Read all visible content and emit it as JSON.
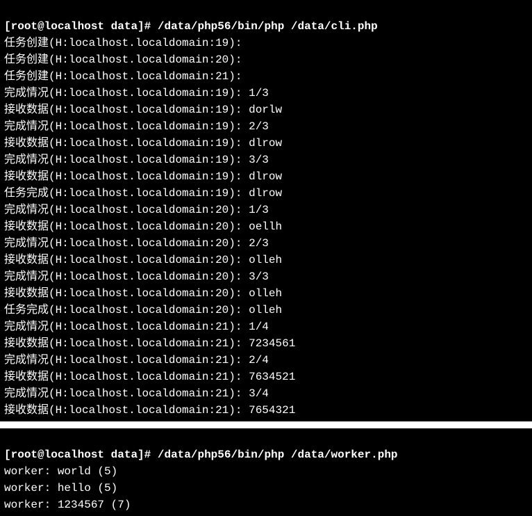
{
  "terminal1": {
    "prompt": {
      "open": "[",
      "user_host": "root@localhost",
      "sep": " ",
      "cwd": "data",
      "close": "]# ",
      "command": "/data/php56/bin/php /data/cli.php"
    },
    "lines": [
      {
        "label": "任务创建",
        "host": "H:localhost.localdomain",
        "id": "19",
        "after": ":",
        "extra": ""
      },
      {
        "label": "任务创建",
        "host": "H:localhost.localdomain",
        "id": "20",
        "after": ":",
        "extra": ""
      },
      {
        "label": "任务创建",
        "host": "H:localhost.localdomain",
        "id": "21",
        "after": ":",
        "extra": ""
      },
      {
        "label": "完成情况",
        "host": "H:localhost.localdomain",
        "id": "19",
        "after": ": ",
        "extra": "1/3"
      },
      {
        "label": "接收数据",
        "host": "H:localhost.localdomain",
        "id": "19",
        "after": ": ",
        "extra": "dorlw"
      },
      {
        "label": "完成情况",
        "host": "H:localhost.localdomain",
        "id": "19",
        "after": ": ",
        "extra": "2/3"
      },
      {
        "label": "接收数据",
        "host": "H:localhost.localdomain",
        "id": "19",
        "after": ": ",
        "extra": "dlrow"
      },
      {
        "label": "完成情况",
        "host": "H:localhost.localdomain",
        "id": "19",
        "after": ": ",
        "extra": "3/3"
      },
      {
        "label": "接收数据",
        "host": "H:localhost.localdomain",
        "id": "19",
        "after": ": ",
        "extra": "dlrow"
      },
      {
        "label": "任务完成",
        "host": "H:localhost.localdomain",
        "id": "19",
        "after": ": ",
        "extra": "dlrow"
      },
      {
        "label": "完成情况",
        "host": "H:localhost.localdomain",
        "id": "20",
        "after": ": ",
        "extra": "1/3"
      },
      {
        "label": "接收数据",
        "host": "H:localhost.localdomain",
        "id": "20",
        "after": ": ",
        "extra": "oellh"
      },
      {
        "label": "完成情况",
        "host": "H:localhost.localdomain",
        "id": "20",
        "after": ": ",
        "extra": "2/3"
      },
      {
        "label": "接收数据",
        "host": "H:localhost.localdomain",
        "id": "20",
        "after": ": ",
        "extra": "olleh"
      },
      {
        "label": "完成情况",
        "host": "H:localhost.localdomain",
        "id": "20",
        "after": ": ",
        "extra": "3/3"
      },
      {
        "label": "接收数据",
        "host": "H:localhost.localdomain",
        "id": "20",
        "after": ": ",
        "extra": "olleh"
      },
      {
        "label": "任务完成",
        "host": "H:localhost.localdomain",
        "id": "20",
        "after": ": ",
        "extra": "olleh"
      },
      {
        "label": "完成情况",
        "host": "H:localhost.localdomain",
        "id": "21",
        "after": ": ",
        "extra": "1/4"
      },
      {
        "label": "接收数据",
        "host": "H:localhost.localdomain",
        "id": "21",
        "after": ": ",
        "extra": "7234561"
      },
      {
        "label": "完成情况",
        "host": "H:localhost.localdomain",
        "id": "21",
        "after": ": ",
        "extra": "2/4"
      },
      {
        "label": "接收数据",
        "host": "H:localhost.localdomain",
        "id": "21",
        "after": ": ",
        "extra": "7634521"
      },
      {
        "label": "完成情况",
        "host": "H:localhost.localdomain",
        "id": "21",
        "after": ": ",
        "extra": "3/4"
      },
      {
        "label": "接收数据",
        "host": "H:localhost.localdomain",
        "id": "21",
        "after": ": ",
        "extra": "7654321"
      }
    ]
  },
  "terminal2": {
    "prompt": {
      "open": "[",
      "user_host": "root@localhost",
      "sep": " ",
      "cwd": "data",
      "close": "]# ",
      "command": "/data/php56/bin/php /data/worker.php"
    },
    "lines": [
      {
        "text": "worker: world (5)"
      },
      {
        "text": "worker: hello (5)"
      },
      {
        "text": "worker: 1234567 (7)"
      }
    ]
  }
}
